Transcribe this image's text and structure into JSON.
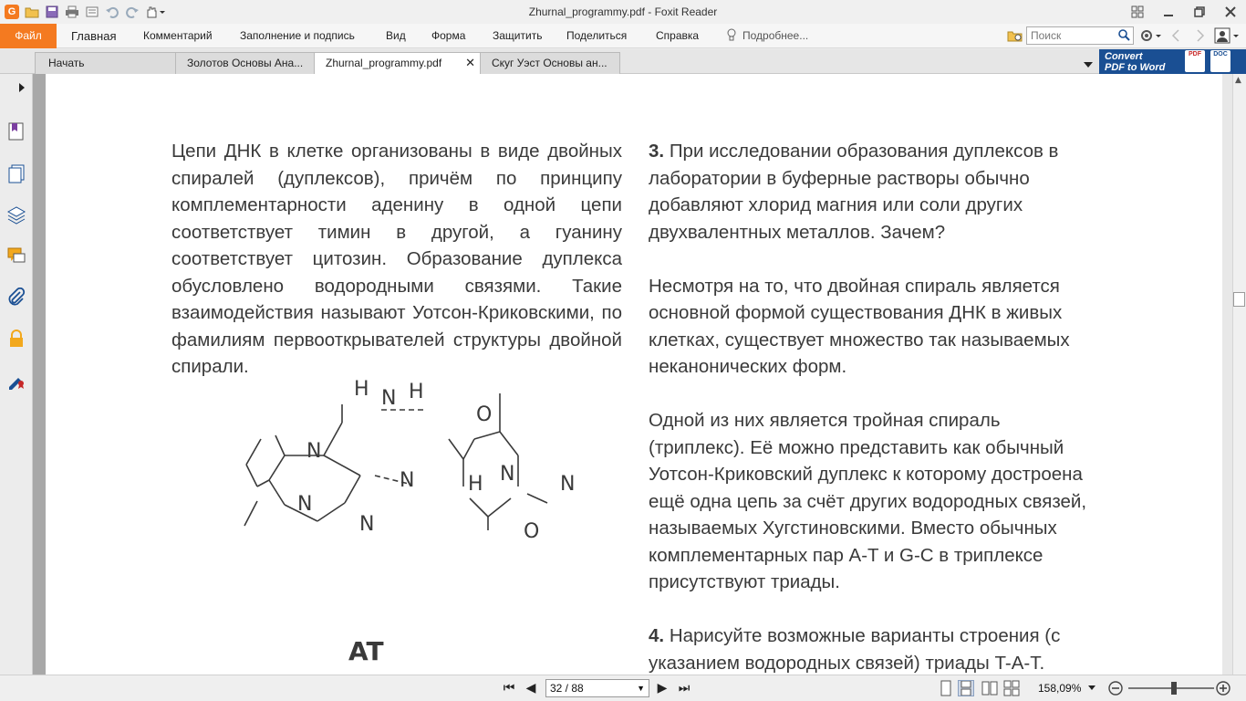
{
  "window": {
    "title": "Zhurnal_programmy.pdf - Foxit Reader",
    "app_logo": "G",
    "quick_access_icons": [
      "open-folder-icon",
      "save-icon",
      "print-icon",
      "properties-icon",
      "undo-icon",
      "redo-icon",
      "hand-tool-icon"
    ],
    "controls": [
      "ribbon-options-icon",
      "minimize-icon",
      "restore-icon",
      "close-icon"
    ]
  },
  "menu": {
    "file": "Файл",
    "tabs": [
      "Главная",
      "Комментарий",
      "Заполнение и подпись",
      "Вид",
      "Форма",
      "Защитить",
      "Поделиться",
      "Справка"
    ],
    "active_tab": "Главная",
    "tell_me": "Подробнее...",
    "search_placeholder": "Поиск"
  },
  "doc_tabs": [
    {
      "label": "Начать",
      "active": false
    },
    {
      "label": "Золотов Основы Ана...",
      "active": false
    },
    {
      "label": "Zhurnal_programmy.pdf",
      "active": true
    },
    {
      "label": "Скуг Уэст Основы ан...",
      "active": false
    }
  ],
  "convert": {
    "line1": "Convert",
    "line2": "PDF to Word",
    "badge_pdf": "PDF",
    "badge_doc": "DOC"
  },
  "sidebar_icons": [
    "bookmark-icon",
    "pages-icon",
    "layers-icon",
    "comments-icon",
    "attachments-icon",
    "security-icon",
    "signature-icon"
  ],
  "page": {
    "left_column": "Цепи ДНК в клетке организованы в виде двойных спиралей (дуплексов), причём по принципу комплементарности аденину в одной цепи соответствует тимин в другой, а гуанину соответствует цитозин. Образование дуплекса обусловлено водородными связями. Такие взаимодействия называют Уотсон-Криковскими, по фамилиям первооткрывателей структуры двойной спирали.",
    "right_column": {
      "q3_num": "3.",
      "q3_text": "При исследовании образования дуплексов в лаборатории в буферные растворы обычно добавляют хлорид магния или соли других двухвалентных металлов. Зачем?",
      "p2": "Несмотря на то, что двойная спираль является основной формой существования ДНК в живых клетках, существует множество так называемых неканонических форм.",
      "p3": "Одной из них является тройная спираль (триплекс). Её можно представить как обычный Уотсон-Криковский дуплекс к которому достроена ещё одна цепь за счёт других водородных связей, называемых Хугстиновскими. Вместо обычных комплементарных пар A-T и G-C в триплексе присутствуют триады.",
      "q4_num": "4.",
      "q4_text": "Нарисуйте возможные варианты строения (с указанием водородных связей) триады T-A-T."
    },
    "figure": {
      "pair_label": "AT",
      "atoms": {
        "h": "H",
        "n": "N",
        "o": "O"
      }
    }
  },
  "status": {
    "page_indicator": "32 / 88",
    "zoom": "158,09%",
    "zoom_fraction": 0.5
  }
}
